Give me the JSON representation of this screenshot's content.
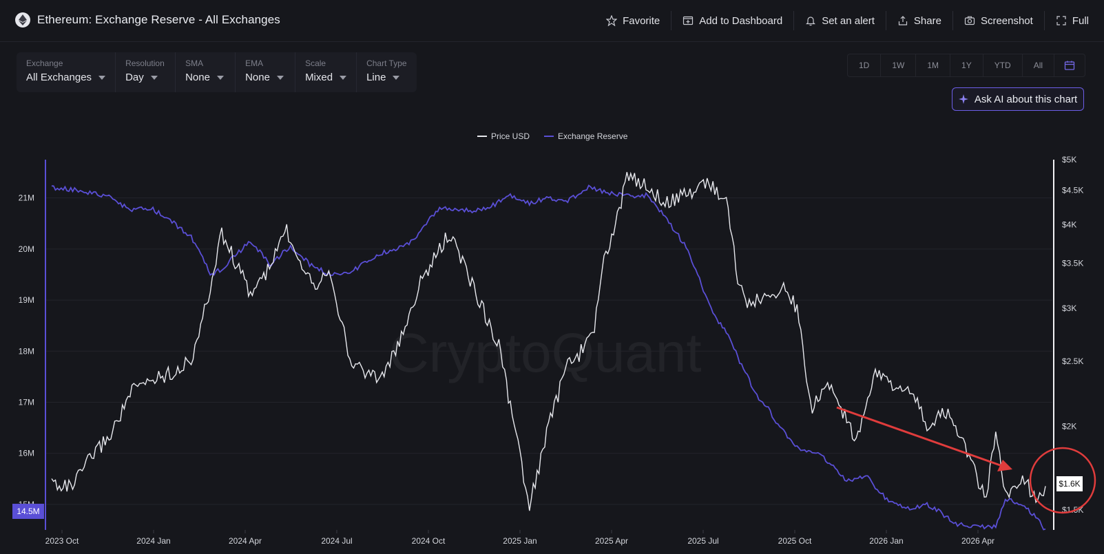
{
  "header": {
    "title": "Ethereum: Exchange Reserve - All Exchanges",
    "actions": [
      {
        "label": "Favorite",
        "icon": "star-icon"
      },
      {
        "label": "Add to Dashboard",
        "icon": "dashboard-add-icon"
      },
      {
        "label": "Set an alert",
        "icon": "bell-icon"
      },
      {
        "label": "Share",
        "icon": "share-icon"
      },
      {
        "label": "Screenshot",
        "icon": "camera-icon"
      },
      {
        "label": "Full",
        "icon": "fullscreen-icon"
      }
    ]
  },
  "filters": [
    {
      "label": "Exchange",
      "value": "All Exchanges"
    },
    {
      "label": "Resolution",
      "value": "Day"
    },
    {
      "label": "SMA",
      "value": "None"
    },
    {
      "label": "EMA",
      "value": "None"
    },
    {
      "label": "Scale",
      "value": "Mixed"
    },
    {
      "label": "Chart Type",
      "value": "Line"
    }
  ],
  "ranges": [
    "1D",
    "1W",
    "1M",
    "1Y",
    "YTD",
    "All"
  ],
  "ask_ai": {
    "label": "Ask AI about this chart"
  },
  "watermark": "CryptoQuant",
  "colors": {
    "background": "#16171c",
    "price": "#e8e9ee",
    "reserve": "#5a4fd6",
    "annotation": "#e03c3c",
    "accent": "#6c5ee8"
  },
  "chart_data": {
    "type": "line",
    "legend": [
      "Price USD",
      "Exchange Reserve"
    ],
    "legend_position": "top-center",
    "x": [
      "2023 Oct",
      "2024 Jan",
      "2024 Apr",
      "2024 Jul",
      "2024 Oct",
      "2025 Jan",
      "2025 Apr",
      "2025 Jul",
      "2025 Oct",
      "2026 Jan",
      "2026 Apr"
    ],
    "left_axis": {
      "name": "Exchange Reserve",
      "ticks": [
        "21M",
        "20M",
        "19M",
        "18M",
        "17M",
        "16M",
        "15M"
      ],
      "tick_values": [
        21000000,
        20000000,
        19000000,
        18000000,
        17000000,
        16000000,
        15000000
      ],
      "range": [
        14500000,
        21750000
      ],
      "current_label": "14.5M"
    },
    "right_axis": {
      "name": "Price USD",
      "scale": "log",
      "ticks": [
        "$5K",
        "$4.5K",
        "$4K",
        "$3.5K",
        "$3K",
        "$2.5K",
        "$2K",
        "$1.5K"
      ],
      "tick_values": [
        5000,
        4500,
        4000,
        3500,
        3000,
        2500,
        2000,
        1500
      ],
      "range": [
        1400,
        5000
      ],
      "current_label": "$1.6K"
    },
    "series": [
      {
        "name": "Price USD",
        "axis": "right",
        "t": [
          0.0,
          0.02,
          0.04,
          0.06,
          0.08,
          0.1,
          0.12,
          0.14,
          0.16,
          0.17,
          0.18,
          0.2,
          0.22,
          0.235,
          0.25,
          0.265,
          0.28,
          0.3,
          0.33,
          0.35,
          0.37,
          0.4,
          0.42,
          0.44,
          0.45,
          0.46,
          0.47,
          0.48,
          0.5,
          0.52,
          0.53,
          0.545,
          0.555,
          0.565,
          0.58,
          0.6,
          0.62,
          0.64,
          0.66,
          0.68,
          0.69,
          0.7,
          0.71,
          0.72,
          0.735,
          0.75,
          0.765,
          0.78,
          0.8,
          0.81,
          0.82,
          0.83,
          0.85,
          0.86,
          0.87,
          0.88,
          0.9,
          0.92,
          0.94,
          0.95,
          0.96,
          0.97,
          0.98,
          0.99,
          1.0
        ],
        "values": [
          1650,
          1620,
          1800,
          1950,
          2250,
          2350,
          2400,
          2500,
          3200,
          3900,
          3650,
          3150,
          3450,
          3950,
          3550,
          3250,
          3450,
          2500,
          2350,
          2650,
          3250,
          3880,
          3350,
          2850,
          2650,
          2200,
          1850,
          1500,
          2000,
          2500,
          2550,
          2750,
          3500,
          3880,
          4750,
          4550,
          4300,
          4450,
          4650,
          4300,
          3350,
          3000,
          3100,
          3100,
          3250,
          3000,
          2100,
          2350,
          2050,
          1900,
          2200,
          2400,
          2300,
          2250,
          2200,
          2000,
          2100,
          1850,
          1550,
          1950,
          1550,
          1650,
          1650,
          1560,
          1600
        ]
      },
      {
        "name": "Exchange Reserve",
        "axis": "left",
        "t": [
          0.0,
          0.03,
          0.06,
          0.08,
          0.1,
          0.12,
          0.14,
          0.16,
          0.17,
          0.2,
          0.22,
          0.24,
          0.26,
          0.28,
          0.3,
          0.33,
          0.36,
          0.39,
          0.42,
          0.44,
          0.46,
          0.48,
          0.5,
          0.52,
          0.54,
          0.56,
          0.58,
          0.6,
          0.62,
          0.64,
          0.66,
          0.67,
          0.68,
          0.69,
          0.7,
          0.71,
          0.72,
          0.73,
          0.75,
          0.77,
          0.79,
          0.8,
          0.82,
          0.84,
          0.86,
          0.88,
          0.89,
          0.9,
          0.91,
          0.92,
          0.93,
          0.94,
          0.95,
          0.96,
          0.97,
          0.98,
          0.99,
          1.0
        ],
        "values": [
          21200000,
          21150000,
          21000000,
          20750000,
          20800000,
          20550000,
          20250000,
          19500000,
          19600000,
          20150000,
          19700000,
          20050000,
          19700000,
          19500000,
          19550000,
          19900000,
          20100000,
          20800000,
          20750000,
          20800000,
          21050000,
          20900000,
          21000000,
          20950000,
          21200000,
          21100000,
          21050000,
          21050000,
          20550000,
          20000000,
          19000000,
          18600000,
          18350000,
          17900000,
          17500000,
          17100000,
          16900000,
          16600000,
          16100000,
          16000000,
          15700000,
          15450000,
          15550000,
          15100000,
          14900000,
          15000000,
          14900000,
          14750000,
          14600000,
          14600000,
          14550000,
          14550000,
          14550000,
          15100000,
          15050000,
          14950000,
          14750000,
          14500000
        ]
      }
    ],
    "annotations": [
      {
        "type": "arrow",
        "description": "downward trend",
        "color": "#e03c3c"
      },
      {
        "type": "circle",
        "description": "latest values",
        "color": "#e03c3c"
      }
    ]
  }
}
